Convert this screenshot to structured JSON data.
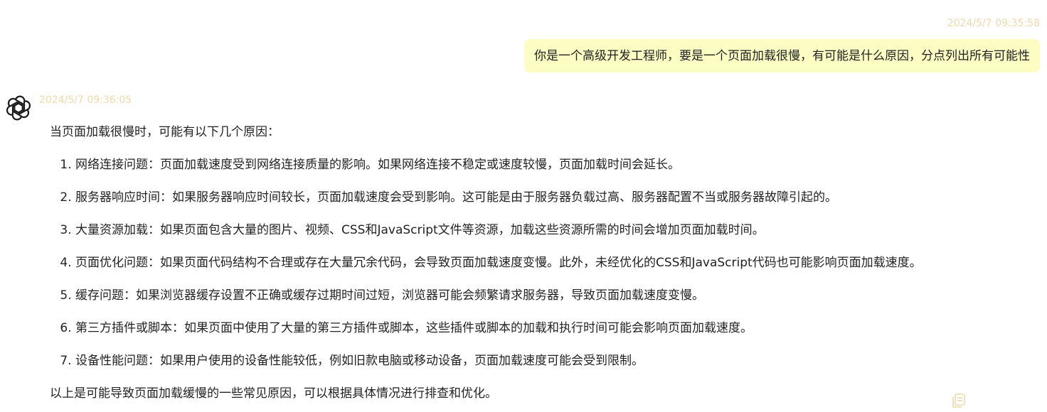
{
  "user_message": {
    "timestamp": "2024/5/7 09:35:58",
    "text": "你是一个高级开发工程师，要是一个页面加载很慢，有可能是什么原因，分点列出所有可能性"
  },
  "assistant_message": {
    "avatar_icon": "openai-logo-icon",
    "timestamp": "2024/5/7 09:36:05",
    "intro": "当页面加载很慢时，可能有以下几个原因：",
    "items": [
      "网络连接问题：页面加载速度受到网络连接质量的影响。如果网络连接不稳定或速度较慢，页面加载时间会延长。",
      "服务器响应时间：如果服务器响应时间较长，页面加载速度会受到影响。这可能是由于服务器负载过高、服务器配置不当或服务器故障引起的。",
      "大量资源加载：如果页面包含大量的图片、视频、CSS和JavaScript文件等资源，加载这些资源所需的时间会增加页面加载时间。",
      "页面优化问题：如果页面代码结构不合理或存在大量冗余代码，会导致页面加载速度变慢。此外，未经优化的CSS和JavaScript代码也可能影响页面加载速度。",
      "缓存问题：如果浏览器缓存设置不正确或缓存过期时间过短，浏览器可能会频繁请求服务器，导致页面加载速度变慢。",
      "第三方插件或脚本：如果页面中使用了大量的第三方插件或脚本，这些插件或脚本的加载和执行时间可能会影响页面加载速度。",
      "设备性能问题：如果用户使用的设备性能较低，例如旧款电脑或移动设备，页面加载速度可能会受到限制。"
    ],
    "outro": "以上是可能导致页面加载缓慢的一些常见原因，可以根据具体情况进行排查和优化。",
    "copy_icon": "copy-icon"
  },
  "colors": {
    "user_bubble_bg": "#fbfdc2",
    "timestamp": "#efd9a8",
    "text": "#222222"
  }
}
